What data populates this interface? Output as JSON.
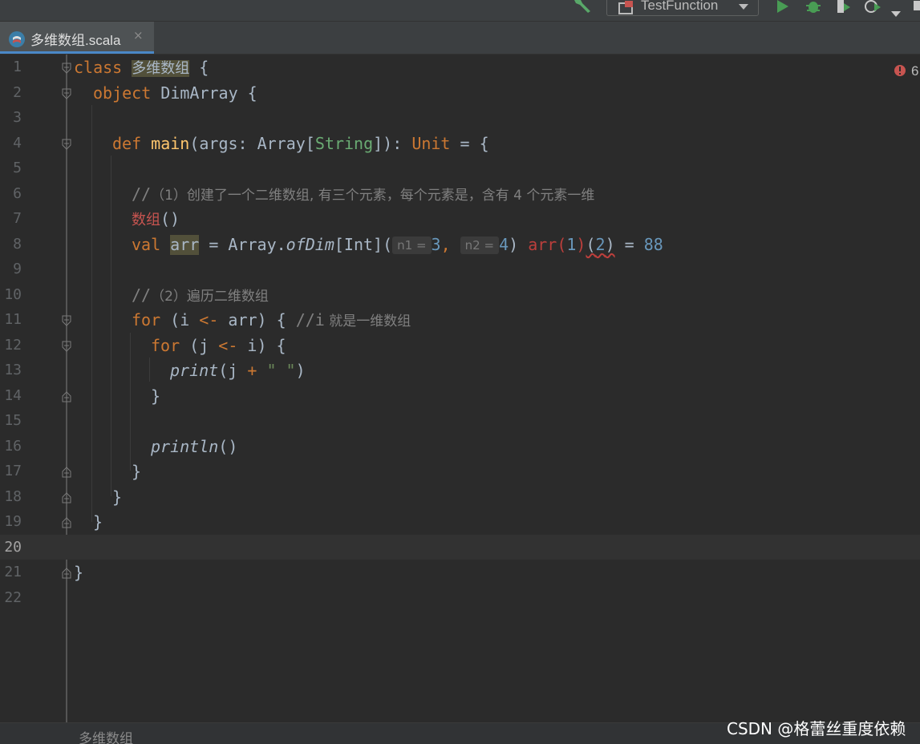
{
  "toolbar": {
    "run_config_label": "TestFunction",
    "icons": [
      "hammer-icon",
      "run-icon",
      "debug-icon",
      "coverage-icon",
      "profiler-icon"
    ]
  },
  "tab": {
    "label": "多维数组.scala",
    "close": "×",
    "icon": "scala-file-icon"
  },
  "editor": {
    "error_count": "6",
    "current_line": 20,
    "line_numbers": [
      "1",
      "2",
      "3",
      "4",
      "5",
      "6",
      "7",
      "8",
      "9",
      "10",
      "11",
      "12",
      "13",
      "14",
      "15",
      "16",
      "17",
      "18",
      "19",
      "20",
      "21",
      "22"
    ]
  },
  "code": {
    "l1": {
      "kw": "class",
      "name": "多维数组",
      "brace": " {"
    },
    "l2": {
      "kw": "object",
      "name": " DimArray {"
    },
    "l4": {
      "kw": "def",
      "fn": "main",
      "a": "(args: Array[",
      "ty": "String",
      "b": "]): ",
      "unit": "Unit",
      "c": " = {"
    },
    "l6": {
      "slashes": "//",
      "text": "（1）创建了一个二维数组, 有三个元素，每个元素是，含有 4 个元素一维"
    },
    "l7": {
      "text": "数组",
      "tail": "()"
    },
    "l8": {
      "kw": "val",
      "var": "arr",
      "a": " = Array.",
      "fn": "ofDim",
      "b": "[Int](",
      "hint1": "n1 =",
      "n1": "3",
      "comma": ", ",
      "hint2": "n2 =",
      "n2": "4",
      "c": ") ",
      "err": "arr",
      "p1": "(",
      "i1": "1",
      "p2": ")",
      "p3": "(",
      "i2": "2",
      "p4": ")",
      "eq": " = ",
      "val": "88"
    },
    "l10": {
      "slashes": "//",
      "text": "（2）遍历二维数组"
    },
    "l11": {
      "kw": "for",
      "a": " (i ",
      "arrow": "<-",
      "b": " arr) { ",
      "slashes": "//i",
      "text": " 就是一维数组"
    },
    "l12": {
      "kw": "for",
      "a": " (j ",
      "arrow": "<-",
      "b": " i) {"
    },
    "l13": {
      "fn": "print",
      "a": "(j ",
      "plus": "+",
      "space": " ",
      "str": "\" \"",
      "b": ")"
    },
    "l14": {
      "text": "}"
    },
    "l16": {
      "fn": "println",
      "a": "()"
    },
    "l17": {
      "text": "}"
    },
    "l18": {
      "text": "}"
    },
    "l19": {
      "text": "}"
    },
    "l21": {
      "text": "}"
    }
  },
  "breadcrumb": {
    "label": "多维数组"
  },
  "watermark": {
    "text": "CSDN @格蕾丝重度依赖"
  }
}
